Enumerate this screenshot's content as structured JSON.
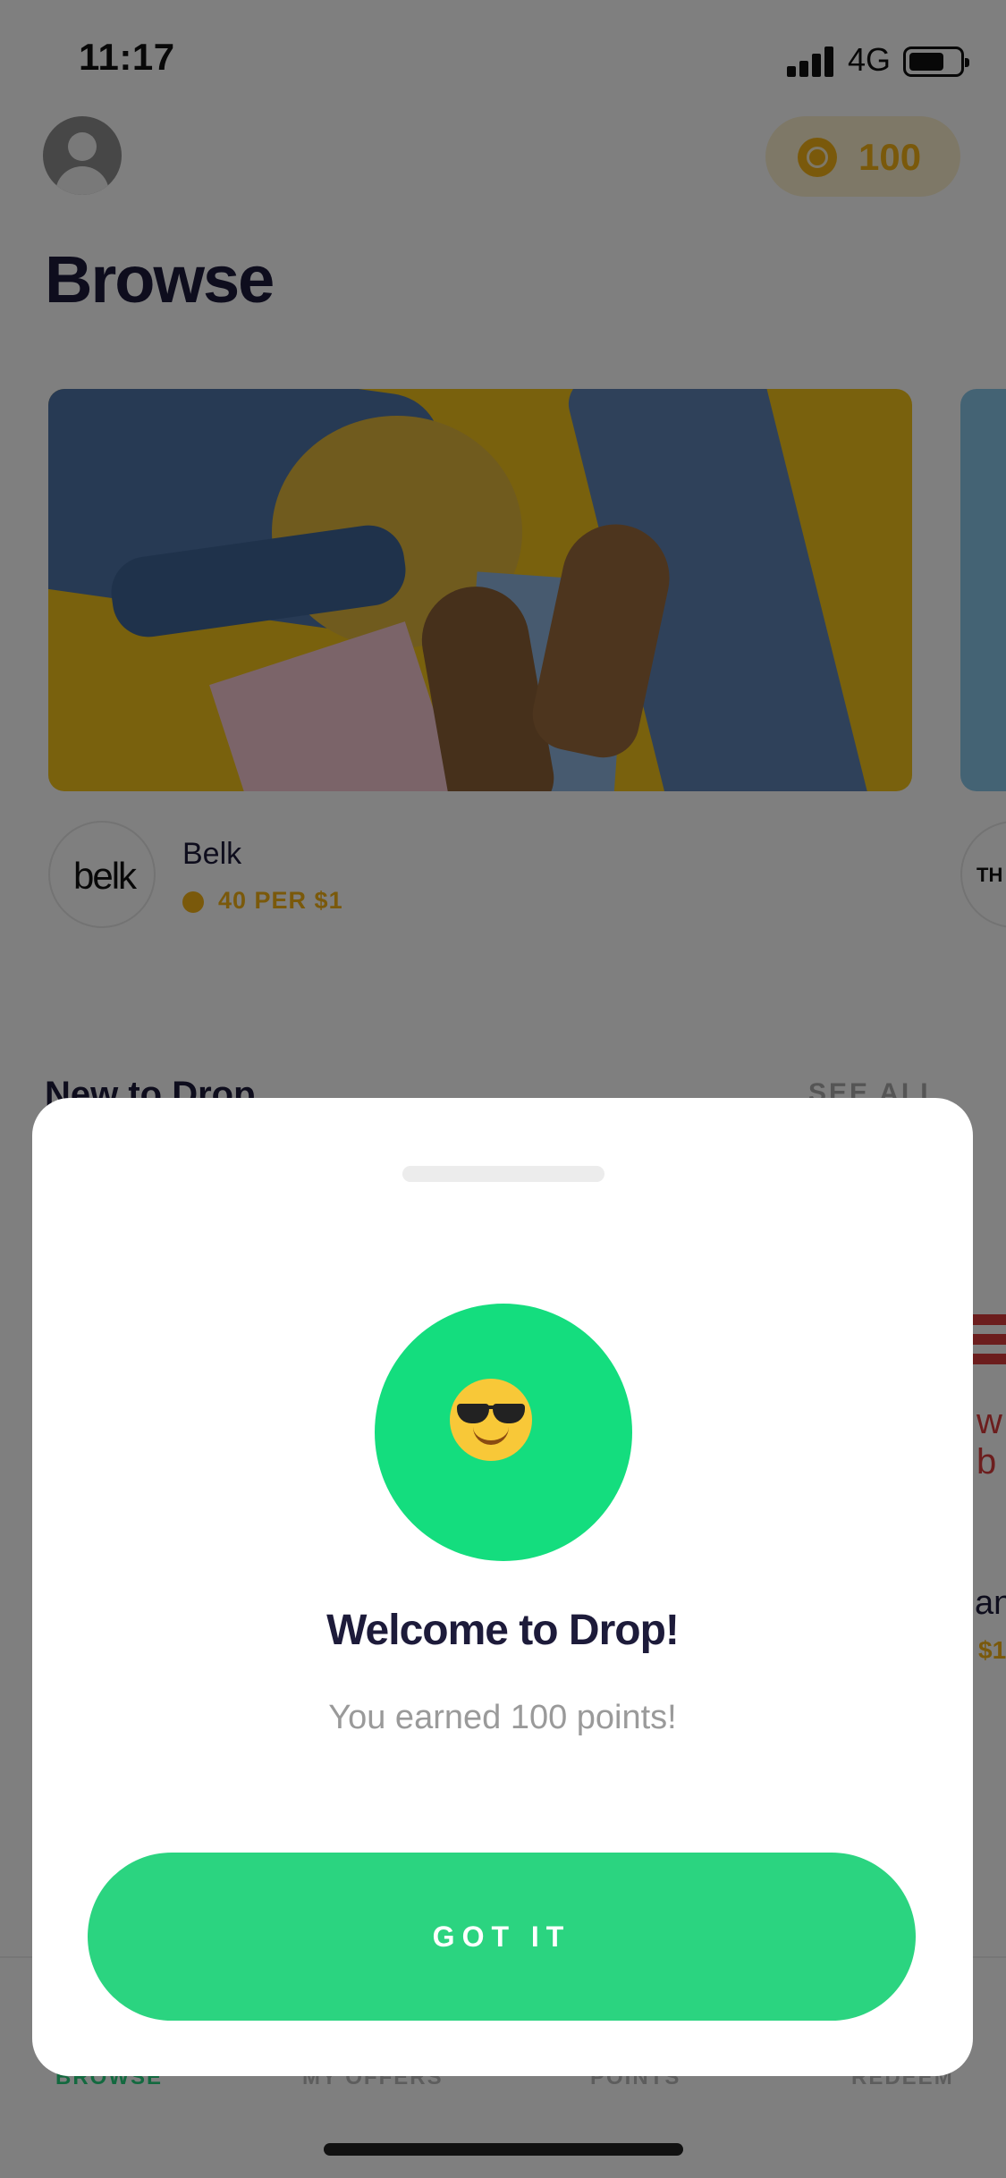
{
  "status_bar": {
    "time": "11:17",
    "network": "4G"
  },
  "header": {
    "points": "100"
  },
  "page": {
    "title": "Browse"
  },
  "featured": {
    "merchant_name": "Belk",
    "merchant_logo_text": "belk",
    "rate": "40 PER $1",
    "next_logo_text": "TH"
  },
  "section": {
    "title": "New to Drop",
    "see_all": "SEE ALL"
  },
  "peek": {
    "logo_text": "w b",
    "name": "an",
    "rate": "$1"
  },
  "tabs": [
    {
      "label": "BROWSE",
      "active": true
    },
    {
      "label": "MY OFFERS",
      "active": false
    },
    {
      "label": "POINTS",
      "active": false
    },
    {
      "label": "REDEEM",
      "active": false
    }
  ],
  "modal": {
    "emoji": "smiling-face-with-sunglasses",
    "title": "Welcome to Drop!",
    "subtitle": "You earned 100 points!",
    "button_label": "GOT IT"
  },
  "colors": {
    "accent_green": "#2bd480",
    "emoji_circle": "#14dd7e",
    "points_gold": "#f5b316",
    "title_navy": "#1d1b3a"
  }
}
